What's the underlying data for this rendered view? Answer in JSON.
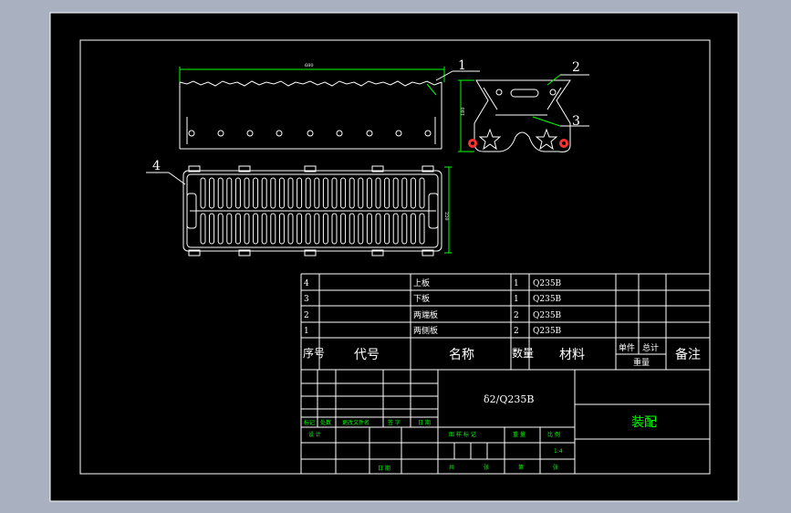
{
  "balloons": {
    "b1": "1",
    "b2": "2",
    "b3": "3",
    "b4": "4"
  },
  "dims": {
    "top_width": "680",
    "side_height": "180",
    "bottom_height": "220"
  },
  "bom": {
    "rows": [
      {
        "no": "4",
        "name": "上板",
        "qty": "1",
        "material": "Q235B"
      },
      {
        "no": "3",
        "name": "下板",
        "qty": "1",
        "material": "Q235B"
      },
      {
        "no": "2",
        "name": "两端板",
        "qty": "2",
        "material": "Q235B"
      },
      {
        "no": "1",
        "name": "两侧板",
        "qty": "2",
        "material": "Q235B"
      }
    ],
    "header": {
      "no": "序号",
      "code": "代号",
      "name": "名称",
      "qty": "数量",
      "material": "材料",
      "unit": "单件",
      "total": "总计",
      "weight": "重量",
      "remark": "备注"
    }
  },
  "title_block": {
    "material_spec": "δ2/Q235B",
    "title": "装配",
    "rev_labels": {
      "mark": "标记",
      "count": "处数",
      "file": "更改文件名",
      "sign": "签 字",
      "date": "日 期"
    },
    "design": "设 计",
    "date2": "日 期",
    "stage": {
      "label": "图 样 标 记",
      "weight": "重 量",
      "scale": "比 例",
      "scale_value": "1:4"
    },
    "sheets": {
      "total": "共",
      "total_unit": "张",
      "sheet": "第",
      "sheet_unit": "张"
    }
  },
  "colors": {
    "background": "#a9b1c1",
    "sheet": "#000000",
    "lines": "#ffffff",
    "green": "#00ff00",
    "red": "#ff3030"
  }
}
